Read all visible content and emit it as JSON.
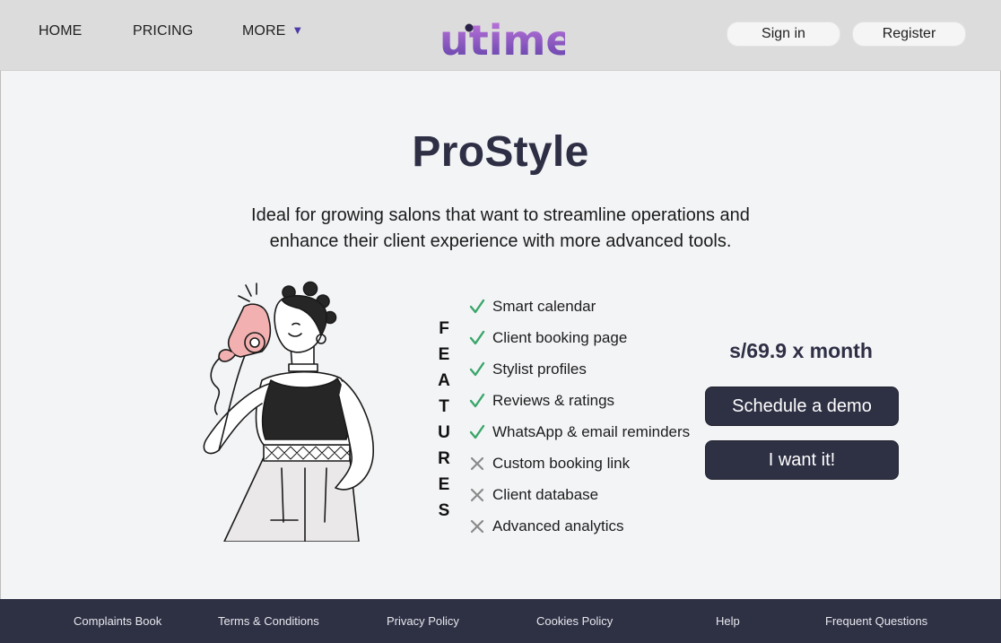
{
  "nav": {
    "home": "HOME",
    "pricing": "PRICING",
    "more": "MORE",
    "more_caret": "▼"
  },
  "brand": {
    "logo_text": "utime",
    "colors": {
      "purple_light": "#c77ae0",
      "purple_dark": "#5b3fa6",
      "dot": "#2a2246"
    }
  },
  "auth": {
    "signin": "Sign in",
    "register": "Register"
  },
  "hero": {
    "title": "ProStyle",
    "description_lines": [
      "Ideal for growing salons that want to streamline operations and",
      "enhance their client experience with more advanced tools."
    ]
  },
  "features": {
    "vertical_label": [
      "F",
      "E",
      "A",
      "T",
      "U",
      "R",
      "E",
      "S"
    ],
    "items": [
      {
        "label": "Smart calendar",
        "included": true,
        "icon": "check-icon"
      },
      {
        "label": "Client booking page",
        "included": true,
        "icon": "check-icon"
      },
      {
        "label": "Stylist profiles",
        "included": true,
        "icon": "check-icon"
      },
      {
        "label": "Reviews & ratings",
        "included": true,
        "icon": "check-icon"
      },
      {
        "label": "WhatsApp & email reminders",
        "included": true,
        "icon": "check-icon"
      },
      {
        "label": "Custom booking link",
        "included": false,
        "icon": "cross-icon"
      },
      {
        "label": "Client database",
        "included": false,
        "icon": "cross-icon"
      },
      {
        "label": "Advanced analytics",
        "included": false,
        "icon": "cross-icon"
      }
    ],
    "colors": {
      "check": "#3aa66a",
      "cross": "#8a8a8a"
    }
  },
  "plan": {
    "price": "s/69.9 x month",
    "demo_button": "Schedule a demo",
    "buy_button": "I want it!"
  },
  "footer": {
    "links": [
      "Complaints Book",
      "Terms & Conditions",
      "Privacy Policy",
      "Cookies Policy",
      "Help",
      "Frequent Questions"
    ]
  },
  "theme": {
    "header_bg": "#dcdcdc",
    "page_bg": "#f3f4f6",
    "dark_navy": "#2e3044"
  }
}
